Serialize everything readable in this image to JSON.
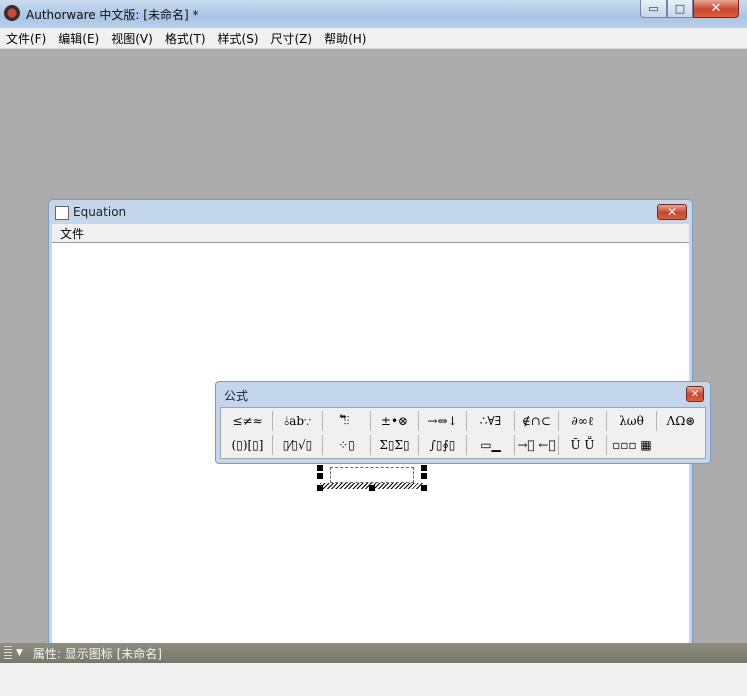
{
  "app": {
    "title": "Authorware 中文版: [未命名] *",
    "menu": [
      "文件(F)",
      "编辑(E)",
      "视图(V)",
      "格式(T)",
      "样式(S)",
      "尺寸(Z)",
      "帮助(H)"
    ],
    "window_controls": {
      "minimize": "▭",
      "maximize": "□",
      "close": "✕"
    }
  },
  "equation_window": {
    "title": "Equation",
    "close": "✕",
    "menu_file": "文件"
  },
  "palette": {
    "title": "公式",
    "close": "✕",
    "row1": [
      "≤≠≈",
      "⫰ab∵",
      "⫶⃗⃖⫶",
      "±•⊗",
      "→⇔↓",
      "∴∀∃",
      "∉∩⊂",
      "∂∞ℓ",
      "λωθ",
      "ΛΩ⊛"
    ],
    "row2": [
      "(▯)[▯]",
      "▯⁄▯√▯",
      "⁘▯",
      "Σ▯Σ▯",
      "∫▯∮▯",
      "▭▁",
      "→⃪ ←⃪",
      "Ū Ṻ",
      "▫▫▫ ▦"
    ]
  },
  "properties": {
    "title": "属性: 显示图标 [未命名]",
    "arrow": "▼"
  }
}
